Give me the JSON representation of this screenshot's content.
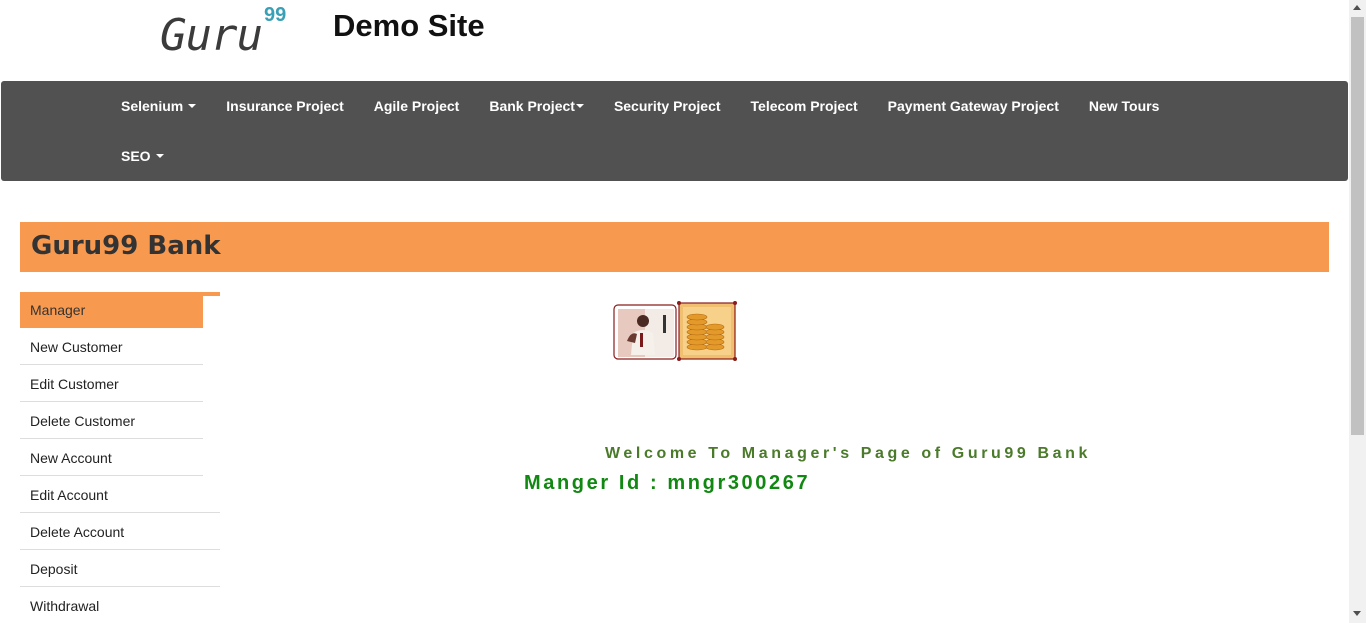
{
  "header": {
    "logo_text": "Guru",
    "logo_sup": "99",
    "site_title": "Demo Site"
  },
  "nav": {
    "row1": [
      {
        "label": "Selenium",
        "dropdown": true
      },
      {
        "label": "Insurance Project",
        "dropdown": false
      },
      {
        "label": "Agile Project",
        "dropdown": false
      },
      {
        "label": "Bank Project",
        "dropdown": true
      },
      {
        "label": "Security Project",
        "dropdown": false
      },
      {
        "label": "Telecom Project",
        "dropdown": false
      },
      {
        "label": "Payment Gateway Project",
        "dropdown": false
      },
      {
        "label": "New Tours",
        "dropdown": false
      }
    ],
    "row2": [
      {
        "label": "SEO",
        "dropdown": true
      }
    ]
  },
  "bank": {
    "title": "Guru99 Bank"
  },
  "sidebar": {
    "items": [
      {
        "label": "Manager",
        "active": true
      },
      {
        "label": "New Customer"
      },
      {
        "label": "Edit Customer"
      },
      {
        "label": "Delete Customer"
      },
      {
        "label": "New Account"
      },
      {
        "label": "Edit Account"
      },
      {
        "label": "Delete Account"
      },
      {
        "label": "Deposit"
      },
      {
        "label": "Withdrawal"
      }
    ]
  },
  "main": {
    "welcome": "Welcome To Manager's Page of Guru99 Bank",
    "manager_id": "Manger Id : mngr300267"
  },
  "colors": {
    "navbar": "#515151",
    "accent": "#f79a50",
    "welcome_text": "#4a7a2a",
    "manager_text": "#118811"
  }
}
